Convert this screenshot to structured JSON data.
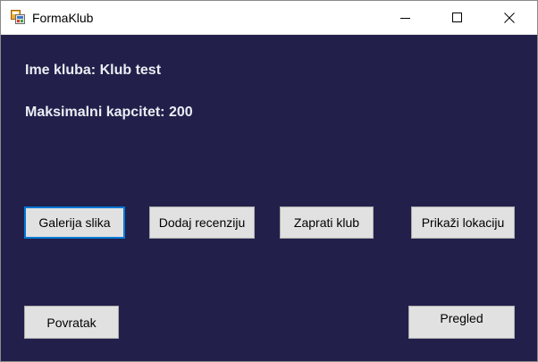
{
  "window": {
    "title": "FormaKlub",
    "app_icon": "winforms-app-icon",
    "minimize_icon": "minimize-icon",
    "maximize_icon": "maximize-icon",
    "close_icon": "close-icon"
  },
  "club": {
    "name_label": "Ime kluba: Klub test",
    "capacity_label": "Maksimalni kapcitet: 200"
  },
  "buttons": {
    "gallery": "Galerija slika",
    "add_review": "Dodaj recenziju",
    "follow": "Zaprati klub",
    "show_location": "Prikaži lokaciju",
    "back": "Povratak",
    "overview": "Pregled"
  },
  "colors": {
    "client_background": "#22204a",
    "button_face": "#e1e1e1",
    "focus_border": "#0078d7",
    "label_text": "#ececf4"
  }
}
